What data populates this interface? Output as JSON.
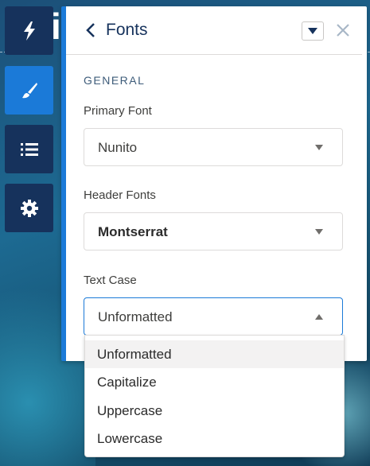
{
  "panel": {
    "title": "Fonts",
    "section": "GENERAL",
    "fields": [
      {
        "label": "Primary Font",
        "value": "Nunito"
      },
      {
        "label": "Header Fonts",
        "value": "Montserrat"
      },
      {
        "label": "Text Case",
        "value": "Unformatted"
      }
    ],
    "text_case_options": [
      "Unformatted",
      "Capitalize",
      "Uppercase",
      "Lowercase"
    ],
    "highlighted_option": "Unformatted"
  },
  "sidebar": {
    "items": [
      {
        "icon": "lightning-icon",
        "active": false
      },
      {
        "icon": "brush-icon",
        "active": true
      },
      {
        "icon": "list-icon",
        "active": false
      },
      {
        "icon": "gear-icon",
        "active": false
      }
    ]
  },
  "colors": {
    "accent": "#1b7ad8",
    "rail": "#16325c",
    "title": "#16325c"
  }
}
